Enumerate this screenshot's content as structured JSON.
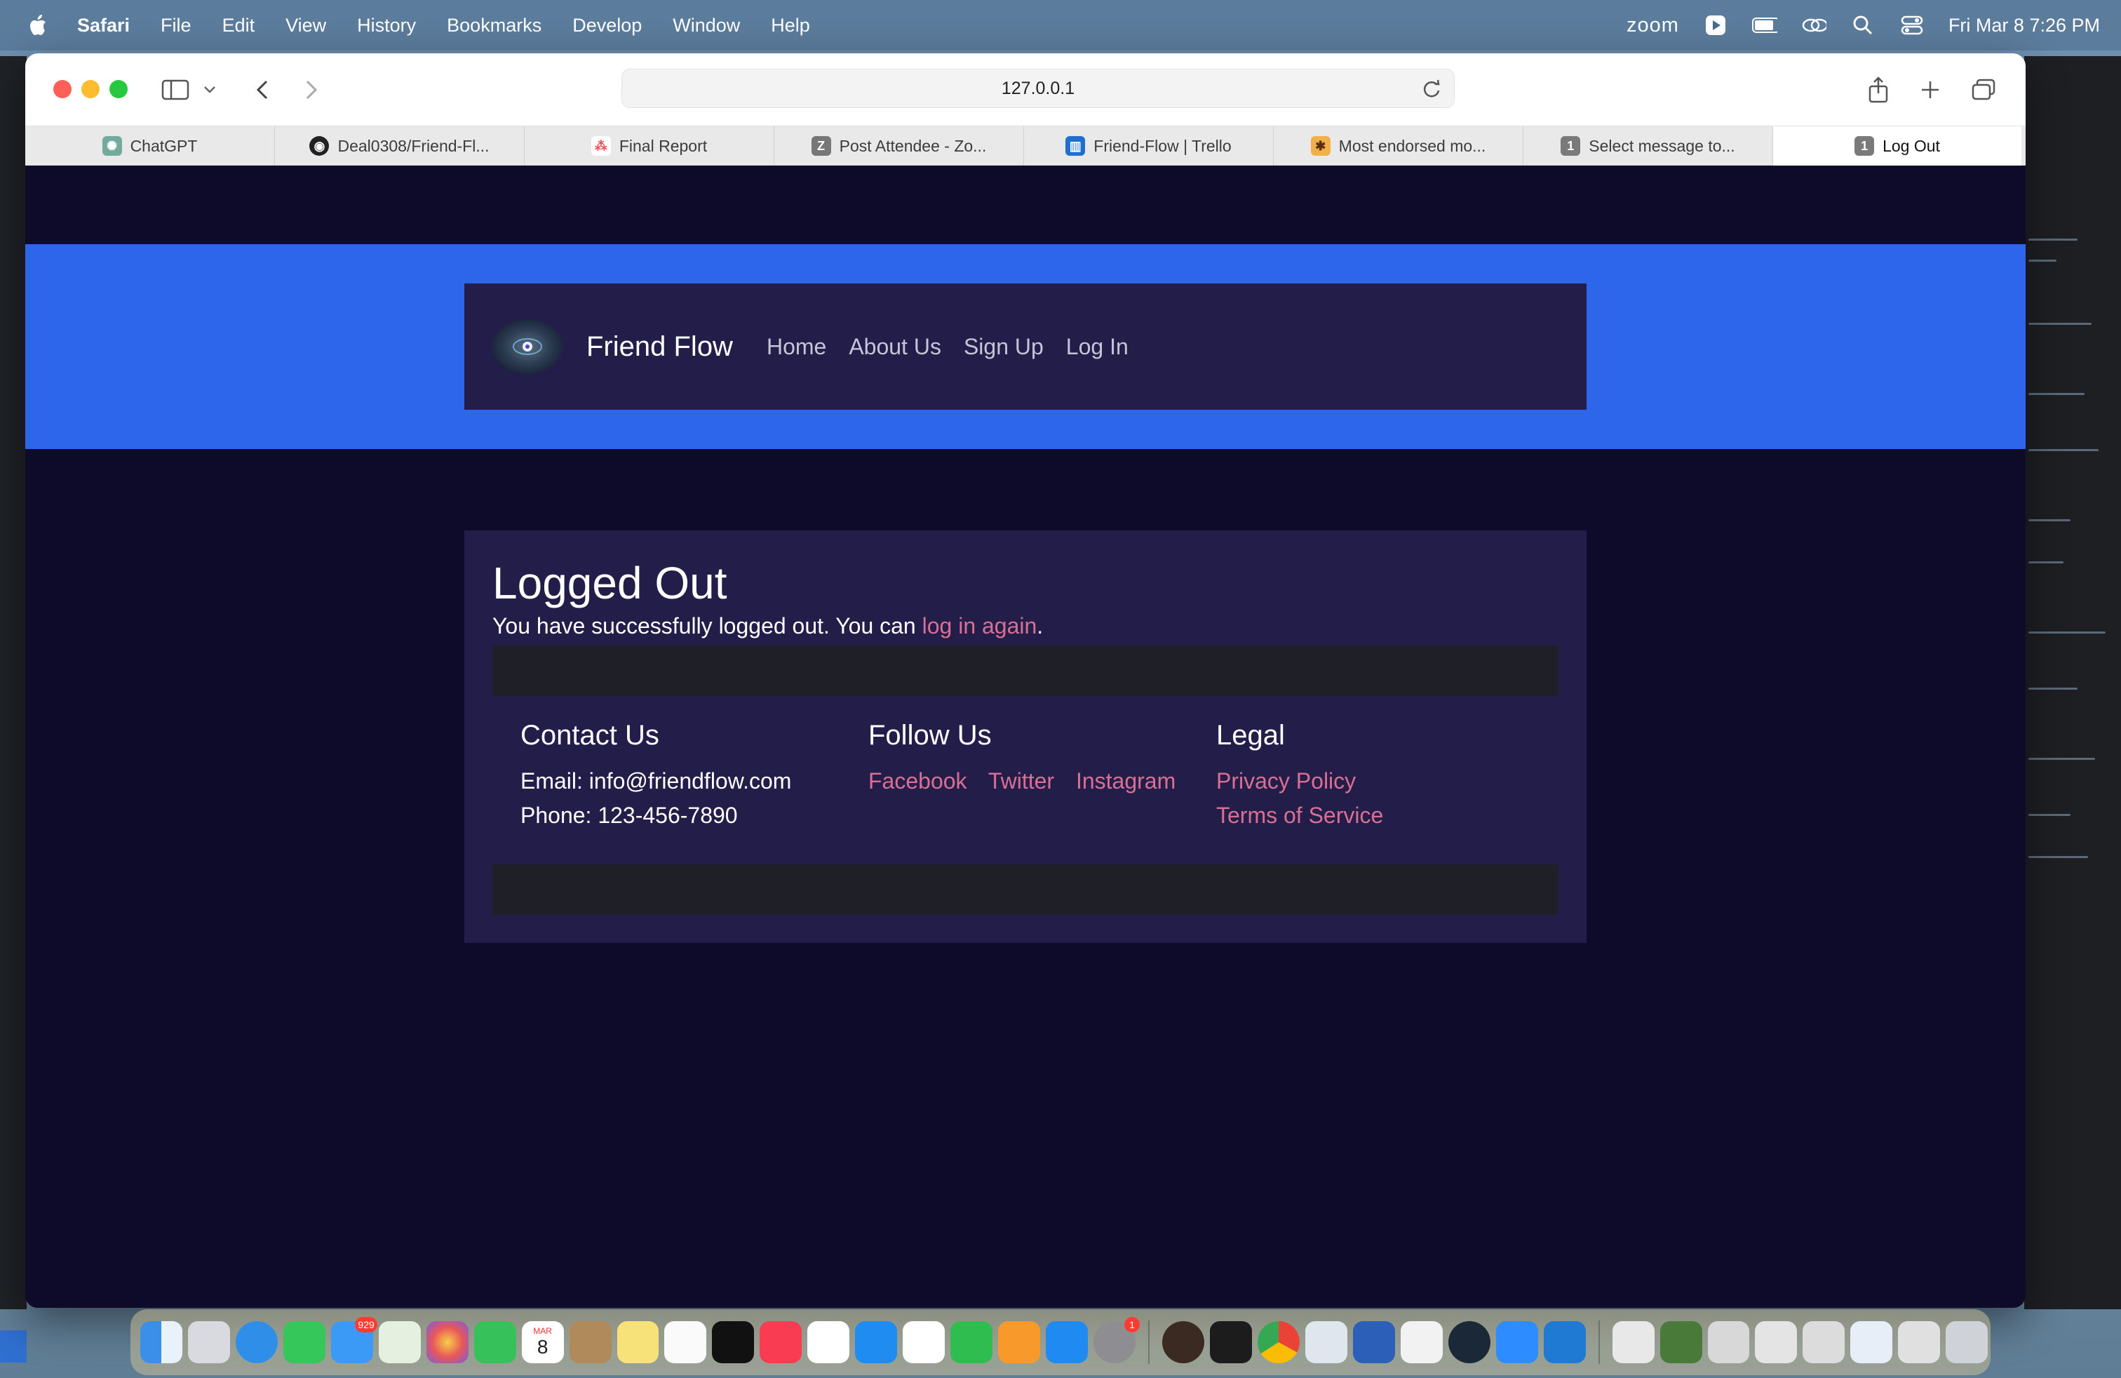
{
  "menubar": {
    "app": "Safari",
    "items": [
      "File",
      "Edit",
      "View",
      "History",
      "Bookmarks",
      "Develop",
      "Window",
      "Help"
    ],
    "zoom": "zoom",
    "datetime": "Fri Mar 8  7:26 PM"
  },
  "browser": {
    "address": "127.0.0.1",
    "tabs": [
      {
        "label": "ChatGPT",
        "icon": "chatgpt-icon"
      },
      {
        "label": "Deal0308/Friend-Fl...",
        "icon": "github-icon"
      },
      {
        "label": "Final Report",
        "icon": "asana-icon"
      },
      {
        "label": "Post Attendee - Zo...",
        "icon": "z-icon",
        "glyph": "Z"
      },
      {
        "label": "Friend-Flow | Trello",
        "icon": "trello-icon"
      },
      {
        "label": "Most endorsed mo...",
        "icon": "site-icon"
      },
      {
        "label": "Select message to...",
        "icon": "number-icon",
        "glyph": "1"
      },
      {
        "label": "Log Out",
        "icon": "number-icon",
        "glyph": "1",
        "active": true
      }
    ]
  },
  "site": {
    "brand": "Friend Flow",
    "nav": [
      "Home",
      "About Us",
      "Sign Up",
      "Log In"
    ],
    "heading": "Logged Out",
    "message_before": "You have successfully logged out. You can ",
    "message_link": "log in again",
    "message_after": ".",
    "footer": {
      "contact": {
        "title": "Contact Us",
        "email": "Email: info@friendflow.com",
        "phone": "Phone: 123-456-7890"
      },
      "follow": {
        "title": "Follow Us",
        "links": [
          "Facebook",
          "Twitter",
          "Instagram"
        ]
      },
      "legal": {
        "title": "Legal",
        "links": [
          "Privacy Policy",
          "Terms of Service"
        ]
      }
    }
  },
  "dock": {
    "mail_badge": "929",
    "calendar_month": "MAR",
    "calendar_day": "8",
    "settings_badge": "1"
  },
  "colors": {
    "banner": "#2d66ea",
    "page_bg": "#0d0b29",
    "card_bg": "#221e49",
    "link": "#d96f93"
  }
}
